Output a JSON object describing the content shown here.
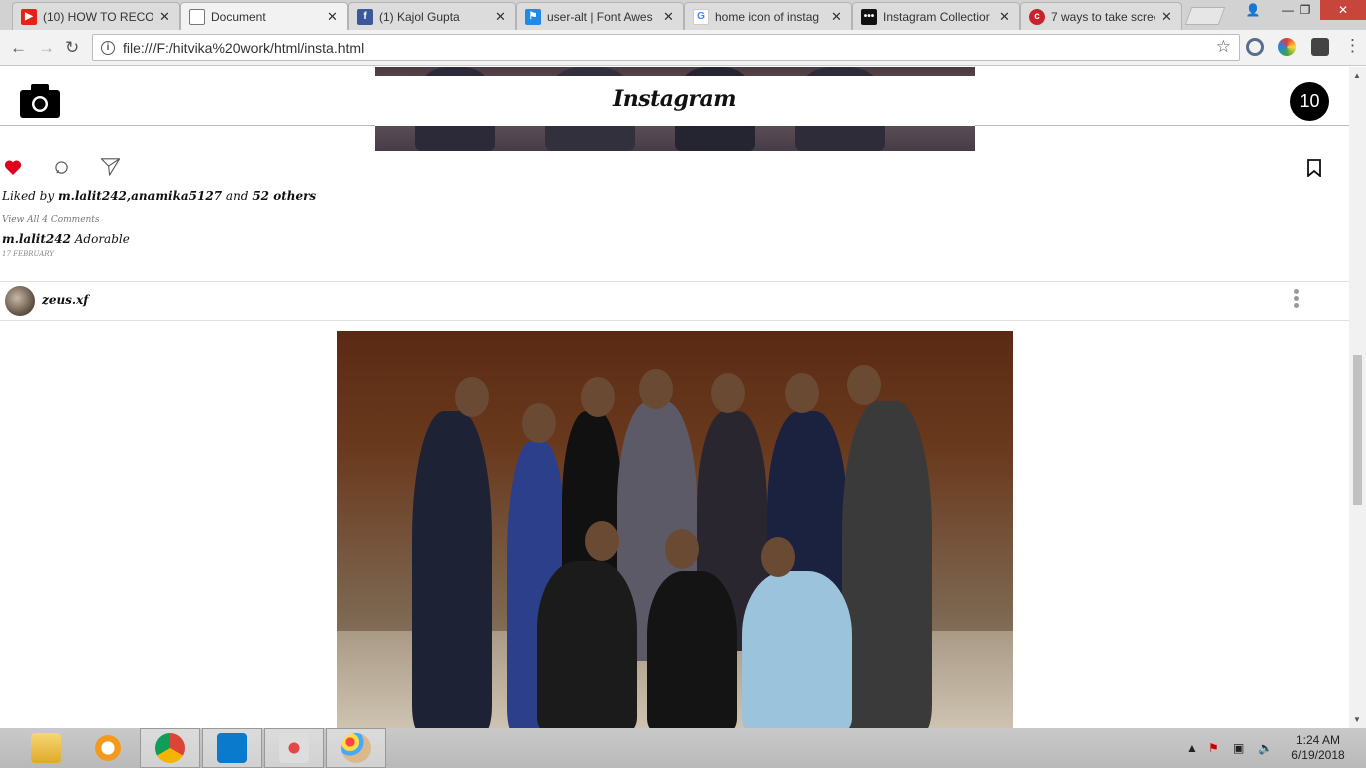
{
  "browser": {
    "tabs": [
      {
        "title": "(10) HOW TO RECOR",
        "favicon": "youtube-icon",
        "color": "#e62117",
        "active": false
      },
      {
        "title": "Document",
        "favicon": "document-icon",
        "color": "#ffffff",
        "active": true
      },
      {
        "title": "(1) Kajol Gupta",
        "favicon": "facebook-icon",
        "color": "#3b5998",
        "active": false
      },
      {
        "title": "user-alt | Font Awes",
        "favicon": "flag-icon",
        "color": "#228ae6",
        "active": false
      },
      {
        "title": "home icon of instag",
        "favicon": "google-icon",
        "color": "#4285f4",
        "active": false
      },
      {
        "title": "Instagram Collectior",
        "favicon": "dots-icon",
        "color": "#111111",
        "active": false
      },
      {
        "title": "7 ways to take scree",
        "favicon": "c-icon",
        "color": "#c8232c",
        "active": false
      }
    ],
    "url": "file:///F:/hitvika%20work/html/insta.html"
  },
  "header": {
    "logo": "Instagram",
    "badge": "10"
  },
  "post1": {
    "liked_prefix": "Liked by",
    "liked_users": "m.lalit242,anamika5127",
    "liked_and": "and",
    "liked_others": "52 others",
    "view_comments": "View All 4 Comments",
    "comment_user": "m.lalit242",
    "comment_text": "Adorable",
    "date": "17 FEBRUARY"
  },
  "post2": {
    "username": "zeus.xf"
  },
  "taskbar": {
    "time": "1:24 AM",
    "date": "6/19/2018"
  },
  "colors": {
    "heart": "#e0001b",
    "accent": "#000000"
  }
}
